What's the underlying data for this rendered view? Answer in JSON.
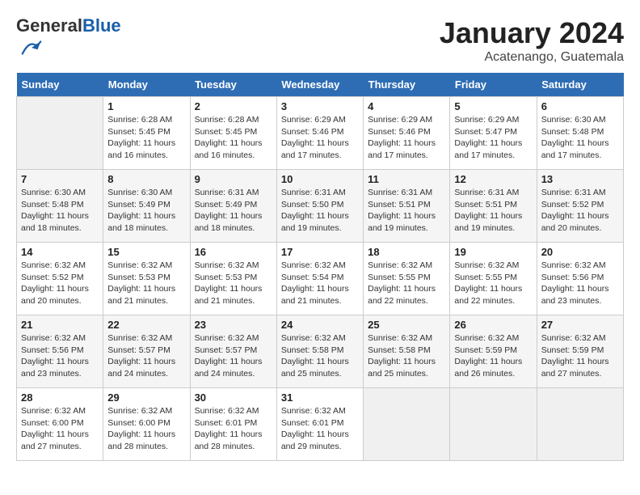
{
  "header": {
    "logo_general": "General",
    "logo_blue": "Blue",
    "month_title": "January 2024",
    "location": "Acatenango, Guatemala"
  },
  "calendar": {
    "columns": [
      "Sunday",
      "Monday",
      "Tuesday",
      "Wednesday",
      "Thursday",
      "Friday",
      "Saturday"
    ],
    "weeks": [
      [
        {
          "day": "",
          "sunrise": "",
          "sunset": "",
          "daylight": ""
        },
        {
          "day": "1",
          "sunrise": "Sunrise: 6:28 AM",
          "sunset": "Sunset: 5:45 PM",
          "daylight": "Daylight: 11 hours and 16 minutes."
        },
        {
          "day": "2",
          "sunrise": "Sunrise: 6:28 AM",
          "sunset": "Sunset: 5:45 PM",
          "daylight": "Daylight: 11 hours and 16 minutes."
        },
        {
          "day": "3",
          "sunrise": "Sunrise: 6:29 AM",
          "sunset": "Sunset: 5:46 PM",
          "daylight": "Daylight: 11 hours and 17 minutes."
        },
        {
          "day": "4",
          "sunrise": "Sunrise: 6:29 AM",
          "sunset": "Sunset: 5:46 PM",
          "daylight": "Daylight: 11 hours and 17 minutes."
        },
        {
          "day": "5",
          "sunrise": "Sunrise: 6:29 AM",
          "sunset": "Sunset: 5:47 PM",
          "daylight": "Daylight: 11 hours and 17 minutes."
        },
        {
          "day": "6",
          "sunrise": "Sunrise: 6:30 AM",
          "sunset": "Sunset: 5:48 PM",
          "daylight": "Daylight: 11 hours and 17 minutes."
        }
      ],
      [
        {
          "day": "7",
          "sunrise": "Sunrise: 6:30 AM",
          "sunset": "Sunset: 5:48 PM",
          "daylight": "Daylight: 11 hours and 18 minutes."
        },
        {
          "day": "8",
          "sunrise": "Sunrise: 6:30 AM",
          "sunset": "Sunset: 5:49 PM",
          "daylight": "Daylight: 11 hours and 18 minutes."
        },
        {
          "day": "9",
          "sunrise": "Sunrise: 6:31 AM",
          "sunset": "Sunset: 5:49 PM",
          "daylight": "Daylight: 11 hours and 18 minutes."
        },
        {
          "day": "10",
          "sunrise": "Sunrise: 6:31 AM",
          "sunset": "Sunset: 5:50 PM",
          "daylight": "Daylight: 11 hours and 19 minutes."
        },
        {
          "day": "11",
          "sunrise": "Sunrise: 6:31 AM",
          "sunset": "Sunset: 5:51 PM",
          "daylight": "Daylight: 11 hours and 19 minutes."
        },
        {
          "day": "12",
          "sunrise": "Sunrise: 6:31 AM",
          "sunset": "Sunset: 5:51 PM",
          "daylight": "Daylight: 11 hours and 19 minutes."
        },
        {
          "day": "13",
          "sunrise": "Sunrise: 6:31 AM",
          "sunset": "Sunset: 5:52 PM",
          "daylight": "Daylight: 11 hours and 20 minutes."
        }
      ],
      [
        {
          "day": "14",
          "sunrise": "Sunrise: 6:32 AM",
          "sunset": "Sunset: 5:52 PM",
          "daylight": "Daylight: 11 hours and 20 minutes."
        },
        {
          "day": "15",
          "sunrise": "Sunrise: 6:32 AM",
          "sunset": "Sunset: 5:53 PM",
          "daylight": "Daylight: 11 hours and 21 minutes."
        },
        {
          "day": "16",
          "sunrise": "Sunrise: 6:32 AM",
          "sunset": "Sunset: 5:53 PM",
          "daylight": "Daylight: 11 hours and 21 minutes."
        },
        {
          "day": "17",
          "sunrise": "Sunrise: 6:32 AM",
          "sunset": "Sunset: 5:54 PM",
          "daylight": "Daylight: 11 hours and 21 minutes."
        },
        {
          "day": "18",
          "sunrise": "Sunrise: 6:32 AM",
          "sunset": "Sunset: 5:55 PM",
          "daylight": "Daylight: 11 hours and 22 minutes."
        },
        {
          "day": "19",
          "sunrise": "Sunrise: 6:32 AM",
          "sunset": "Sunset: 5:55 PM",
          "daylight": "Daylight: 11 hours and 22 minutes."
        },
        {
          "day": "20",
          "sunrise": "Sunrise: 6:32 AM",
          "sunset": "Sunset: 5:56 PM",
          "daylight": "Daylight: 11 hours and 23 minutes."
        }
      ],
      [
        {
          "day": "21",
          "sunrise": "Sunrise: 6:32 AM",
          "sunset": "Sunset: 5:56 PM",
          "daylight": "Daylight: 11 hours and 23 minutes."
        },
        {
          "day": "22",
          "sunrise": "Sunrise: 6:32 AM",
          "sunset": "Sunset: 5:57 PM",
          "daylight": "Daylight: 11 hours and 24 minutes."
        },
        {
          "day": "23",
          "sunrise": "Sunrise: 6:32 AM",
          "sunset": "Sunset: 5:57 PM",
          "daylight": "Daylight: 11 hours and 24 minutes."
        },
        {
          "day": "24",
          "sunrise": "Sunrise: 6:32 AM",
          "sunset": "Sunset: 5:58 PM",
          "daylight": "Daylight: 11 hours and 25 minutes."
        },
        {
          "day": "25",
          "sunrise": "Sunrise: 6:32 AM",
          "sunset": "Sunset: 5:58 PM",
          "daylight": "Daylight: 11 hours and 25 minutes."
        },
        {
          "day": "26",
          "sunrise": "Sunrise: 6:32 AM",
          "sunset": "Sunset: 5:59 PM",
          "daylight": "Daylight: 11 hours and 26 minutes."
        },
        {
          "day": "27",
          "sunrise": "Sunrise: 6:32 AM",
          "sunset": "Sunset: 5:59 PM",
          "daylight": "Daylight: 11 hours and 27 minutes."
        }
      ],
      [
        {
          "day": "28",
          "sunrise": "Sunrise: 6:32 AM",
          "sunset": "Sunset: 6:00 PM",
          "daylight": "Daylight: 11 hours and 27 minutes."
        },
        {
          "day": "29",
          "sunrise": "Sunrise: 6:32 AM",
          "sunset": "Sunset: 6:00 PM",
          "daylight": "Daylight: 11 hours and 28 minutes."
        },
        {
          "day": "30",
          "sunrise": "Sunrise: 6:32 AM",
          "sunset": "Sunset: 6:01 PM",
          "daylight": "Daylight: 11 hours and 28 minutes."
        },
        {
          "day": "31",
          "sunrise": "Sunrise: 6:32 AM",
          "sunset": "Sunset: 6:01 PM",
          "daylight": "Daylight: 11 hours and 29 minutes."
        },
        {
          "day": "",
          "sunrise": "",
          "sunset": "",
          "daylight": ""
        },
        {
          "day": "",
          "sunrise": "",
          "sunset": "",
          "daylight": ""
        },
        {
          "day": "",
          "sunrise": "",
          "sunset": "",
          "daylight": ""
        }
      ]
    ]
  }
}
